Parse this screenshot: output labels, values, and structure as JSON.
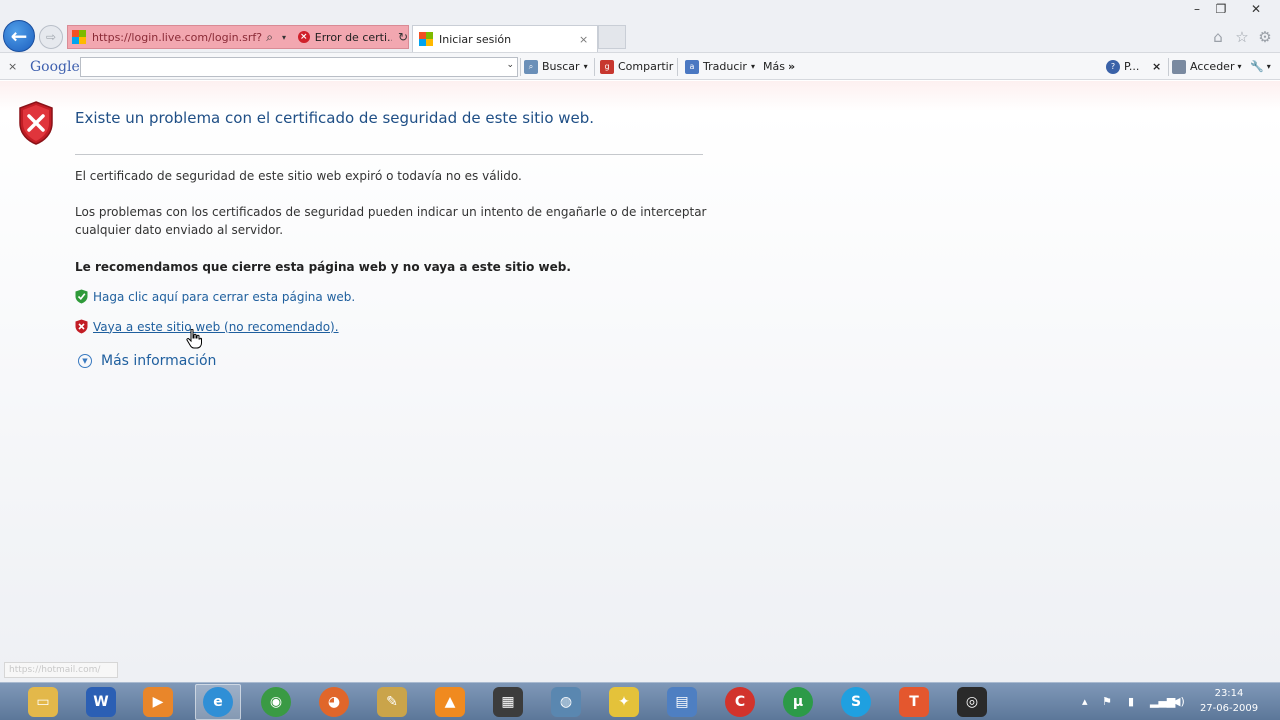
{
  "browser": {
    "address_url": "https://login.live.com/login.srf?wa",
    "cert_error_label": "Error de certi...",
    "tab_title": "Iniciar sesión",
    "tab_close": "×"
  },
  "google_toolbar": {
    "close": "×",
    "logo": "Google",
    "search_value": "",
    "buscar": "Buscar",
    "compartir": "Compartir",
    "traducir": "Traducir",
    "mas": "Más",
    "p_label": "P...",
    "p_close": "×",
    "acceder": "Acceder"
  },
  "page": {
    "title": "Existe un problema con el certificado de seguridad de este sitio web.",
    "paragraph1": "El certificado de seguridad de este sitio web expiró o todavía no es válido.",
    "paragraph2": "Los problemas con los certificados de seguridad pueden indicar un intento de engañarle o de interceptar cualquier dato enviado al servidor.",
    "recommendation": "Le recomendamos que cierre esta página web y no vaya a este sitio web.",
    "close_link": "Haga clic aquí para cerrar esta página web.",
    "continue_link": "Vaya a este sitio web (no recomendado).",
    "more_info": "Más información",
    "status_url": "https://hotmail.com/"
  },
  "taskbar": {
    "time": "23:14",
    "date": "27-06-2009"
  },
  "colors": {
    "address_error_bg": "#f2a7b0",
    "link": "#1f5f9e",
    "title": "#1f4f86",
    "taskbar": "#6a84a6"
  },
  "icons": [
    "back-arrow-icon",
    "forward-arrow-icon",
    "windows-logo-icon",
    "search-icon",
    "certificate-error-icon",
    "refresh-icon",
    "home-icon",
    "star-icon",
    "gear-icon",
    "red-shield-icon",
    "green-shield-icon",
    "expand-circle-icon",
    "hand-cursor-icon"
  ]
}
